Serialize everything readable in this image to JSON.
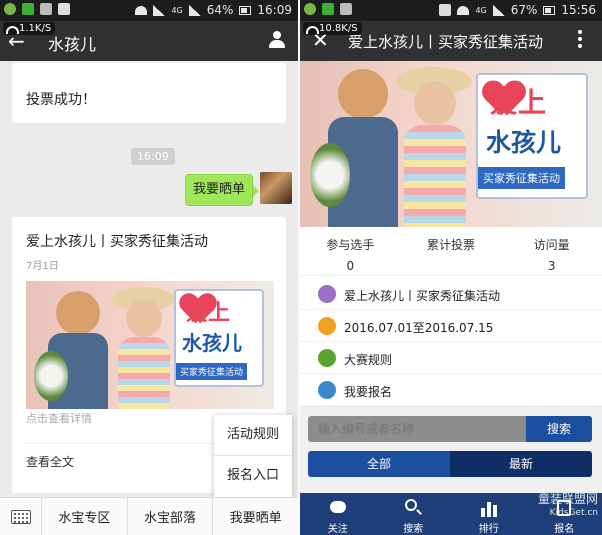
{
  "left": {
    "status": {
      "battery": "64%",
      "time": "16:09",
      "network": "4G"
    },
    "speed": "1.1K/S",
    "title": "水孩儿",
    "messages": {
      "vote_success": "投票成功！",
      "time_stamp": "16:09",
      "sent": "我要晒单"
    },
    "article": {
      "title": "爱上水孩儿丨买家秀征集活动",
      "date": "7月1日",
      "image_heading_1": "爱上",
      "image_heading_2": "水孩儿",
      "image_tag": "买家秀征集活动",
      "hint": "点击查看详情",
      "read_full": "查看全文"
    },
    "popup_menu": [
      "活动规则",
      "报名入口"
    ],
    "bottom_menu": [
      "水宝专区",
      "水宝部落",
      "我要晒单"
    ]
  },
  "right": {
    "status": {
      "battery": "67%",
      "time": "15:56",
      "network": "4G"
    },
    "speed": "10.8K/S",
    "title": "爱上水孩儿丨买家秀征集活动",
    "banner": {
      "heading_1": "爱上",
      "heading_2": "水孩儿",
      "tag": "买家秀征集活动"
    },
    "stats": [
      {
        "label": "参与选手",
        "value": "0"
      },
      {
        "label": "累计投票",
        "value": ""
      },
      {
        "label": "访问量",
        "value": "3"
      }
    ],
    "info": [
      {
        "icon": "heart-icon",
        "color": "#9b6fc6",
        "text": "爱上水孩儿丨买家秀征集活动"
      },
      {
        "icon": "clock-icon",
        "color": "#f2a01f",
        "text": "2016.07.01至2016.07.15"
      },
      {
        "icon": "paperclip-icon",
        "color": "#5aa532",
        "text": "大赛规则"
      },
      {
        "icon": "award-icon",
        "color": "#3b88c9",
        "text": "我要报名"
      }
    ],
    "search": {
      "placeholder": "输入编号或者名称",
      "button": "搜索"
    },
    "segments": [
      "全部",
      "最新"
    ],
    "tabs": [
      "关注",
      "搜索",
      "排行",
      "报名"
    ],
    "watermark": {
      "line1": "童装联盟网",
      "line2": "KidsGet.cn"
    }
  },
  "colors": {
    "navbar": "#2f3133",
    "chat_bg": "#ebebeb",
    "bubble": "#9fe658",
    "accent_blue": "#1c4fa0",
    "tabbar": "#1f3f7a",
    "brand_red": "#e8455a"
  }
}
